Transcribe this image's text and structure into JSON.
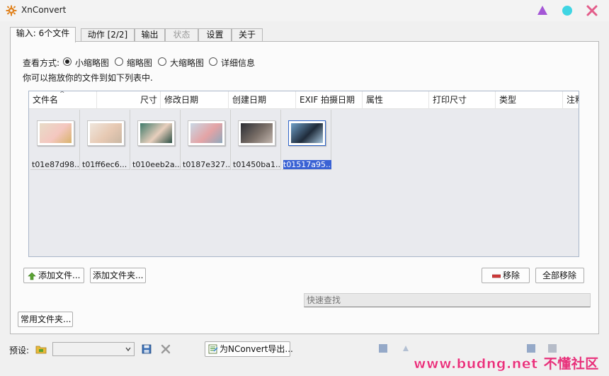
{
  "window": {
    "title": "XnConvert"
  },
  "tabs": [
    {
      "label": "输入: 6个文件",
      "active": true,
      "disabled": false
    },
    {
      "label": "动作 [2/2]",
      "active": false,
      "disabled": false
    },
    {
      "label": "输出",
      "active": false,
      "disabled": false
    },
    {
      "label": "状态",
      "active": false,
      "disabled": true
    },
    {
      "label": "设置",
      "active": false,
      "disabled": false
    },
    {
      "label": "关于",
      "active": false,
      "disabled": false
    }
  ],
  "view_mode": {
    "label": "查看方式:",
    "options": [
      {
        "label": "小缩略图",
        "checked": true
      },
      {
        "label": "缩略图",
        "checked": false
      },
      {
        "label": "大缩略图",
        "checked": false
      },
      {
        "label": "详细信息",
        "checked": false
      }
    ]
  },
  "hint": "你可以拖放你的文件到如下列表中.",
  "file_list": {
    "sort_indicator": "^",
    "columns": [
      "文件名",
      "尺寸",
      "修改日期",
      "创建日期",
      "EXIF 拍摄日期",
      "属性",
      "打印尺寸",
      "类型",
      "注释"
    ],
    "files": [
      {
        "name": "t01e87d98...",
        "selected": false,
        "colors": [
          "#e8dcc8",
          "#f4c7c0",
          "#d9b36c"
        ]
      },
      {
        "name": "t01ff6ec6...",
        "selected": false,
        "colors": [
          "#efe6dc",
          "#e7c9b3",
          "#c9b7a3"
        ]
      },
      {
        "name": "t010eeb2a...",
        "selected": false,
        "colors": [
          "#3f7a6a",
          "#e8cfbd",
          "#2b4f44"
        ]
      },
      {
        "name": "t0187e327...",
        "selected": false,
        "colors": [
          "#c9d8e5",
          "#e4a3a5",
          "#8fa9bd"
        ]
      },
      {
        "name": "t01450ba1...",
        "selected": false,
        "colors": [
          "#2b2d33",
          "#7a6f68",
          "#c2b6ae"
        ]
      },
      {
        "name": "t01517a95...",
        "selected": true,
        "colors": [
          "#6e9fc8",
          "#1f2b3a",
          "#a7c6de"
        ]
      }
    ]
  },
  "buttons": {
    "add_files": "添加文件...",
    "add_folder": "添加文件夹...",
    "remove": "移除",
    "remove_all": "全部移除",
    "common_folders": "常用文件夹...",
    "export_nconvert": "为NConvert导出..."
  },
  "search": {
    "placeholder": "快速查找"
  },
  "bottom": {
    "preset_label": "预设:",
    "preset_value": ""
  },
  "watermark": {
    "url": "www.budng.net",
    "cn": "不懂社区"
  }
}
